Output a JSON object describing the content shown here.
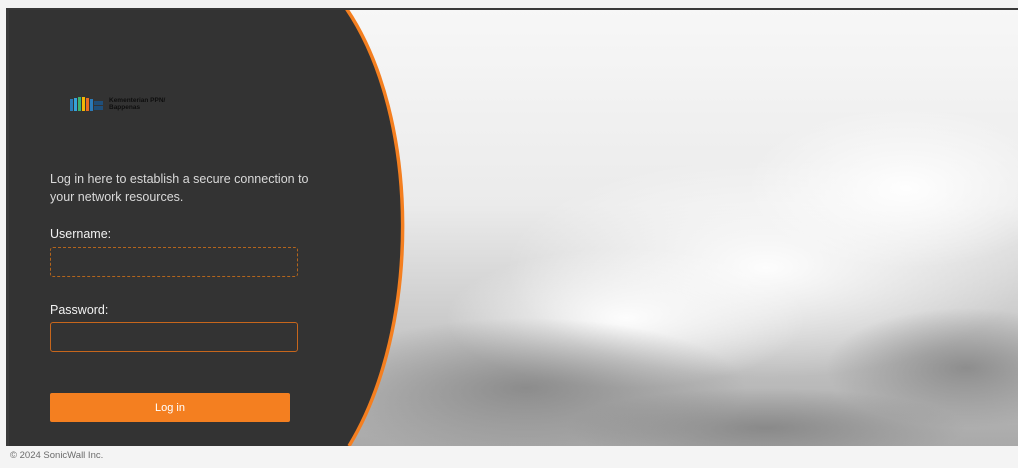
{
  "branding": {
    "logo_text": "Kementerian PPN/ Bappenas",
    "accent_color": "#f47f20",
    "panel_color": "#333333"
  },
  "login": {
    "intro": "Log in here to establish a secure connection to your network resources.",
    "username_label": "Username:",
    "username_value": "",
    "password_label": "Password:",
    "password_value": "",
    "button_label": "Log in"
  },
  "footer": {
    "copyright": "© 2024 SonicWall Inc."
  }
}
